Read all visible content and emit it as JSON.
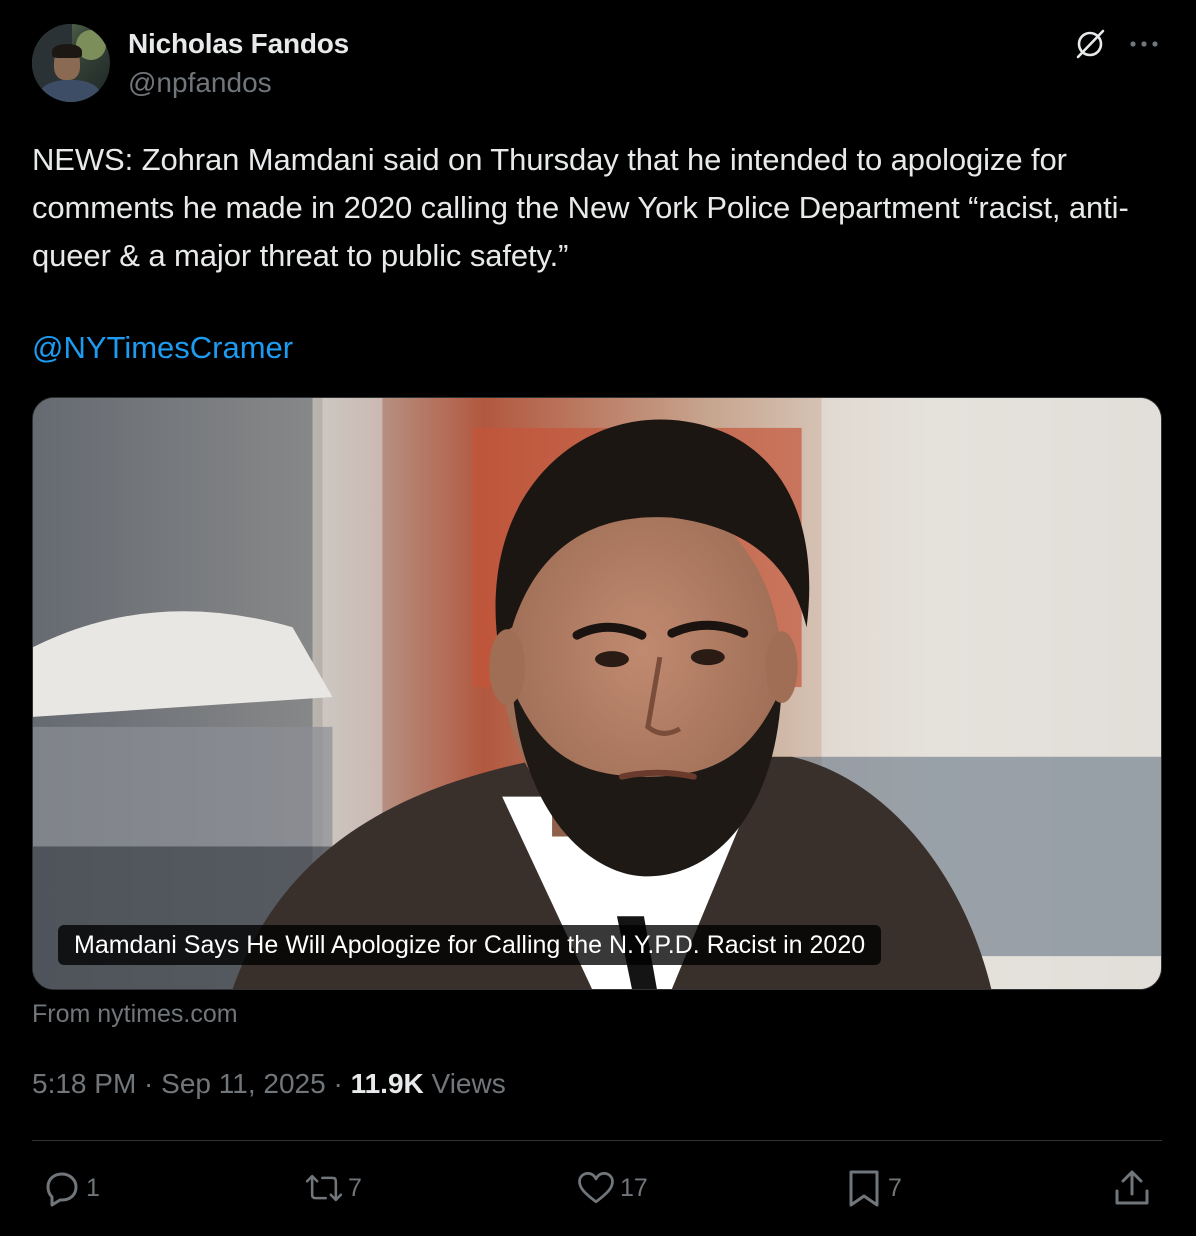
{
  "author": {
    "name": "Nicholas Fandos",
    "handle": "@npfandos"
  },
  "tweet": {
    "text": "NEWS: Zohran Mamdani said on Thursday that he intended to apologize for comments he made in 2020 calling the New York Police Department “racist, anti-queer & a major threat to public safety.”",
    "mention": "@NYTimesCramer"
  },
  "card": {
    "title": "Mamdani Says He Will Apologize for Calling the N.Y.P.D. Racist in 2020",
    "source": "From nytimes.com"
  },
  "meta": {
    "time": "5:18 PM",
    "separator": " · ",
    "date": "Sep 11, 2025",
    "views_count": "11.9K",
    "views_label": " Views"
  },
  "actions": {
    "replies": "1",
    "reposts": "7",
    "likes": "17",
    "bookmarks": "7"
  },
  "icons": {
    "grok": "grok-icon",
    "more": "more-icon",
    "reply": "reply-icon",
    "repost": "repost-icon",
    "like": "heart-icon",
    "bookmark": "bookmark-icon",
    "share": "share-icon"
  },
  "colors": {
    "background": "#000000",
    "text": "#e7e9ea",
    "muted": "#71767b",
    "link": "#1d9bf0",
    "divider": "#2f3336"
  }
}
